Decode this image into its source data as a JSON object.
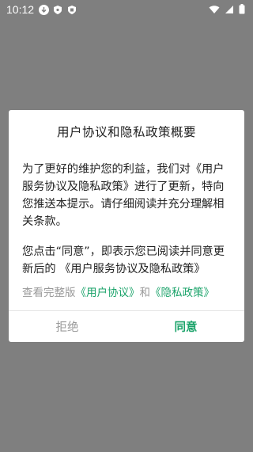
{
  "status_bar": {
    "time": "10:12",
    "icons": [
      "download-icon",
      "shield-icon",
      "shield-check-icon",
      "wifi-icon",
      "signal-icon",
      "battery-icon"
    ]
  },
  "dialog": {
    "title": "用户协议和隐私政策概要",
    "paragraph1": "为了更好的维护您的利益，我们对《用户服务协议及隐私政策》进行了更新，特向您推送本提示。请仔细阅读并充分理解相关条款。",
    "paragraph2": "您点击“同意”，即表示您已阅读并同意更新后的 《用户服务协议及隐私政策》",
    "links_prefix": "查看完整版",
    "link_user_agreement": "《用户协议》",
    "links_and": "和",
    "link_privacy_policy": "《隐私政策》",
    "reject_label": "拒绝",
    "agree_label": "同意"
  },
  "colors": {
    "accent": "#1ba36a",
    "overlay": "#7f7f7f",
    "muted_text": "#999999"
  }
}
